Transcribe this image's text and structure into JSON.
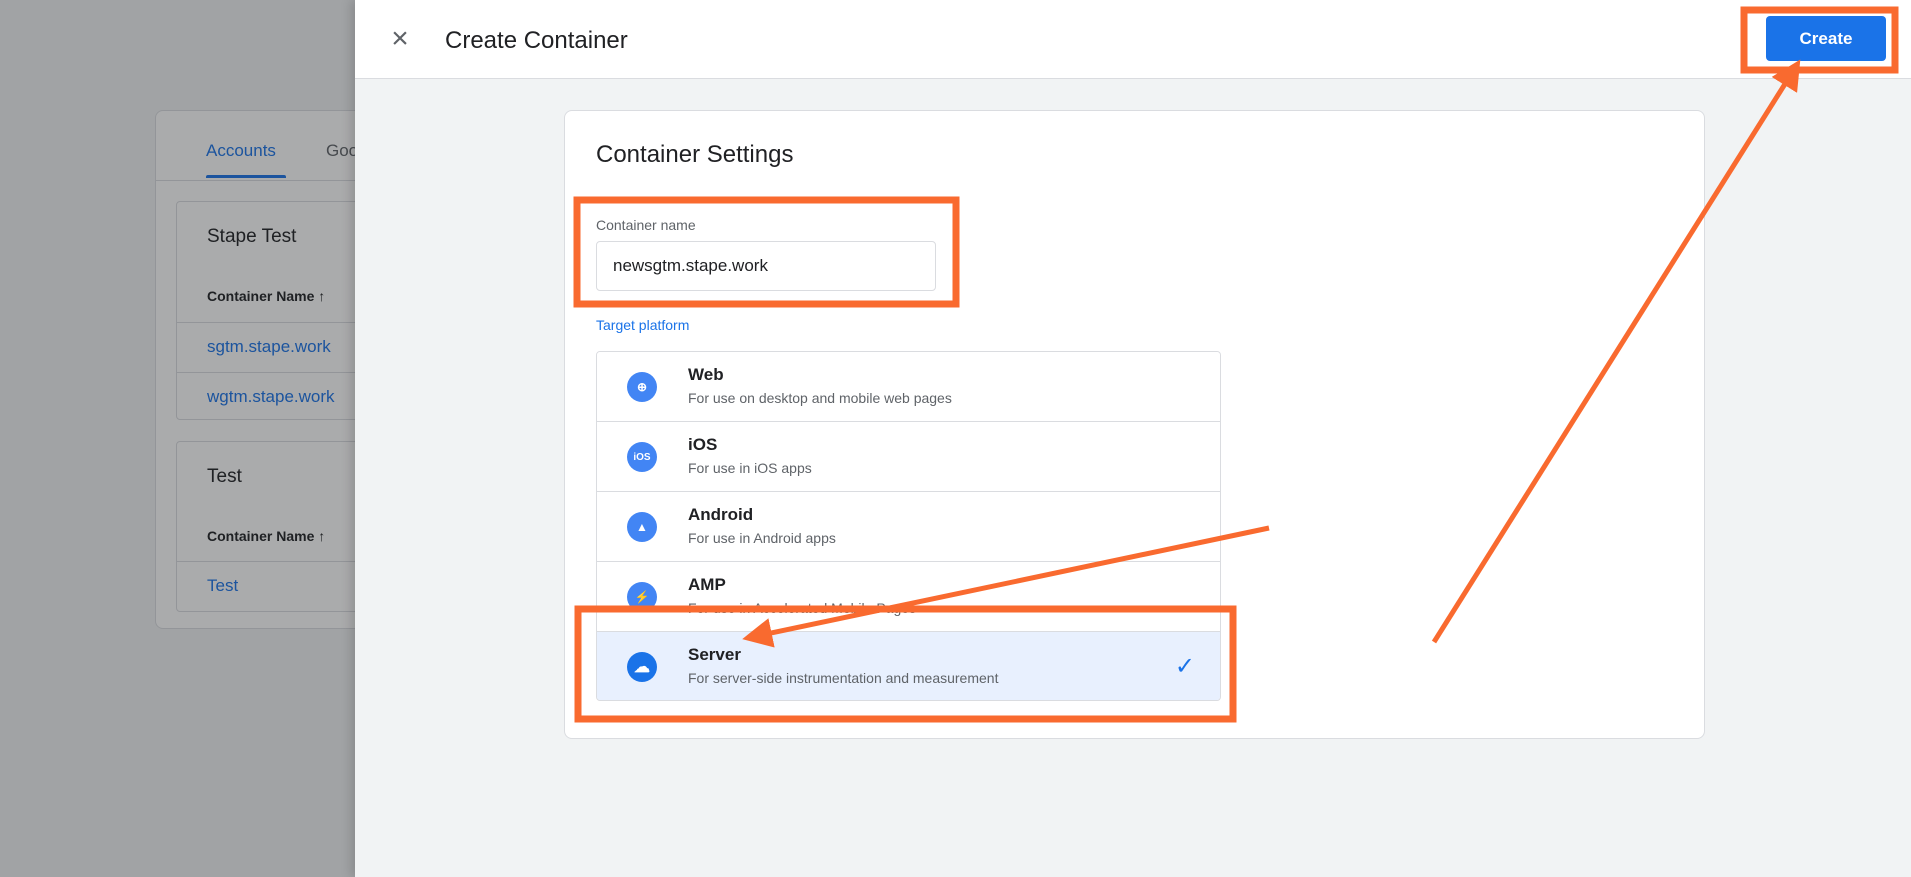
{
  "background": {
    "tabs": [
      "Accounts",
      "Goo"
    ],
    "accounts": [
      {
        "name": "Stape Test",
        "column_header": "Container Name ↑",
        "containers": [
          "sgtm.stape.work",
          "wgtm.stape.work"
        ]
      },
      {
        "name": "Test",
        "column_header": "Container Name ↑",
        "containers": [
          "Test"
        ]
      }
    ]
  },
  "panel": {
    "title": "Create Container",
    "close_icon": "×",
    "create_label": "Create",
    "settings_title": "Container Settings",
    "name_label": "Container name",
    "name_value": "newsgtm.stape.work",
    "target_label": "Target platform",
    "platforms": [
      {
        "icon": "globe-icon",
        "glyph": "⊕",
        "title": "Web",
        "desc": "For use on desktop and mobile web pages"
      },
      {
        "icon": "ios-icon",
        "glyph": "iOS",
        "title": "iOS",
        "desc": "For use in iOS apps"
      },
      {
        "icon": "android-icon",
        "glyph": "▲",
        "title": "Android",
        "desc": "For use in Android apps"
      },
      {
        "icon": "bolt-icon",
        "glyph": "⚡",
        "title": "AMP",
        "desc": "For use in Accelerated Mobile Pages"
      },
      {
        "icon": "cloud-icon",
        "glyph": "☁",
        "title": "Server",
        "desc": "For server-side instrumentation and measurement",
        "selected": true
      }
    ],
    "check_icon": "✓"
  },
  "colors": {
    "accent": "#1a73e8",
    "annotation": "#f96a2f",
    "selected_bg": "#e8f0fe"
  }
}
